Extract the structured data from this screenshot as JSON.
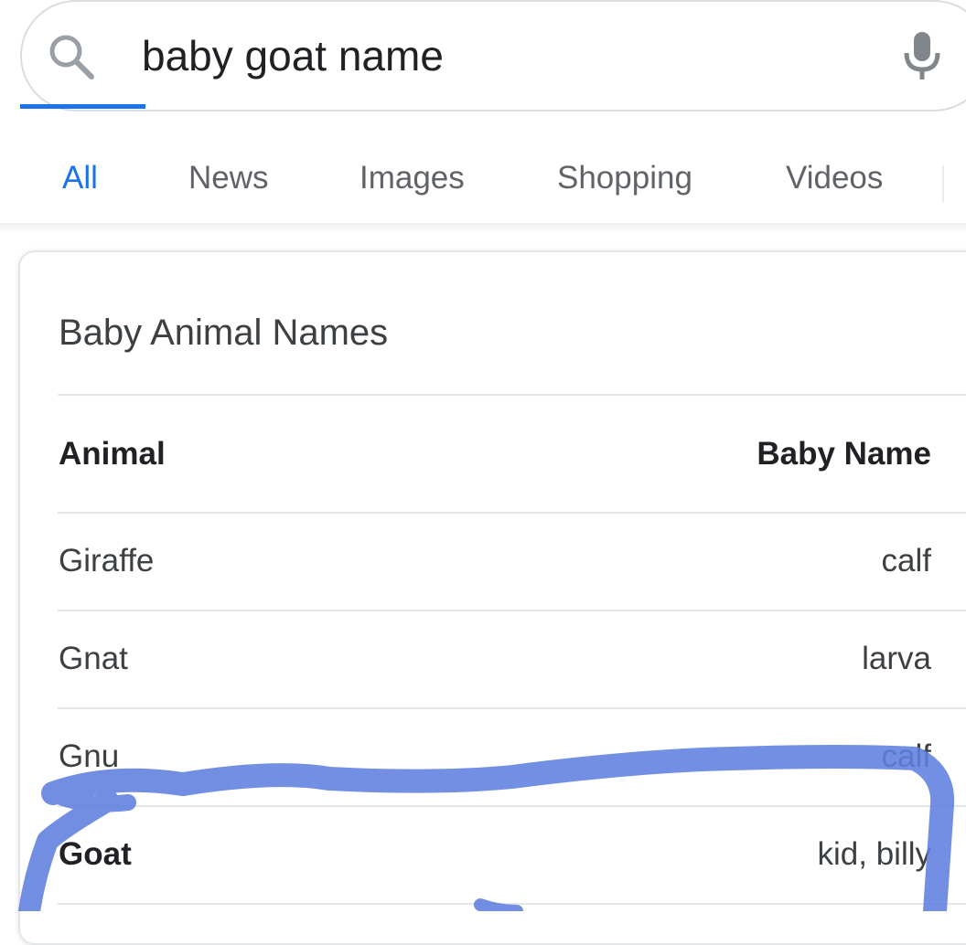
{
  "search": {
    "query": "baby goat name",
    "icons": {
      "search": "search-icon",
      "mic": "microphone-icon"
    }
  },
  "tabs": [
    {
      "label": "All",
      "active": true
    },
    {
      "label": "News",
      "active": false
    },
    {
      "label": "Images",
      "active": false
    },
    {
      "label": "Shopping",
      "active": false
    },
    {
      "label": "Videos",
      "active": false
    }
  ],
  "card": {
    "title": "Baby Animal Names",
    "table": {
      "headers": [
        "Animal",
        "Baby Name"
      ],
      "rows": [
        {
          "animal": "Giraffe",
          "baby": "calf",
          "highlight": false
        },
        {
          "animal": "Gnat",
          "baby": "larva",
          "highlight": false
        },
        {
          "animal": "Gnu",
          "baby": "calf",
          "highlight": false
        },
        {
          "animal": "Goat",
          "baby": "kid, billy",
          "highlight": true
        }
      ]
    }
  },
  "colors": {
    "accent": "#1a73e8",
    "text": "#3c4043",
    "tab_inactive": "#5f6368",
    "annotation": "#5f7fe0"
  }
}
